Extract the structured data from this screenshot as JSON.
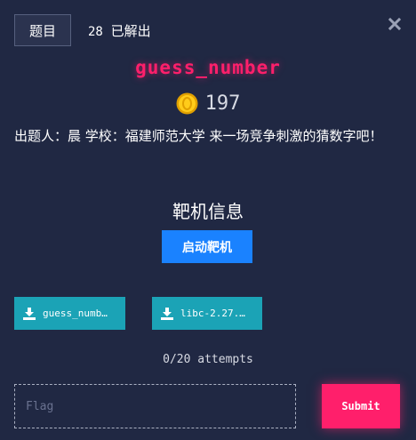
{
  "header": {
    "tab_label": "题目",
    "solves_count": "28",
    "solves_label": "已解出"
  },
  "challenge": {
    "name": "guess_number",
    "points": "197",
    "description": "出题人：晨 学校：福建师范大学 来一场竞争刺激的猜数字吧！"
  },
  "instance": {
    "section_title": "靶机信息",
    "start_label": "启动靶机"
  },
  "files": [
    {
      "label": "guess_numb…"
    },
    {
      "label": "libc-2.27.…"
    }
  ],
  "attempts": {
    "text": "0/20 attempts"
  },
  "flag": {
    "placeholder": "Flag",
    "value": "",
    "submit_label": "Submit"
  },
  "icons": {
    "close": "close-icon",
    "coin": "coin-icon",
    "download": "download-icon"
  },
  "colors": {
    "background": "#202843",
    "accent_pink": "#ff1f6b",
    "primary_blue": "#1a82ff",
    "file_teal": "#1ba3b6"
  }
}
